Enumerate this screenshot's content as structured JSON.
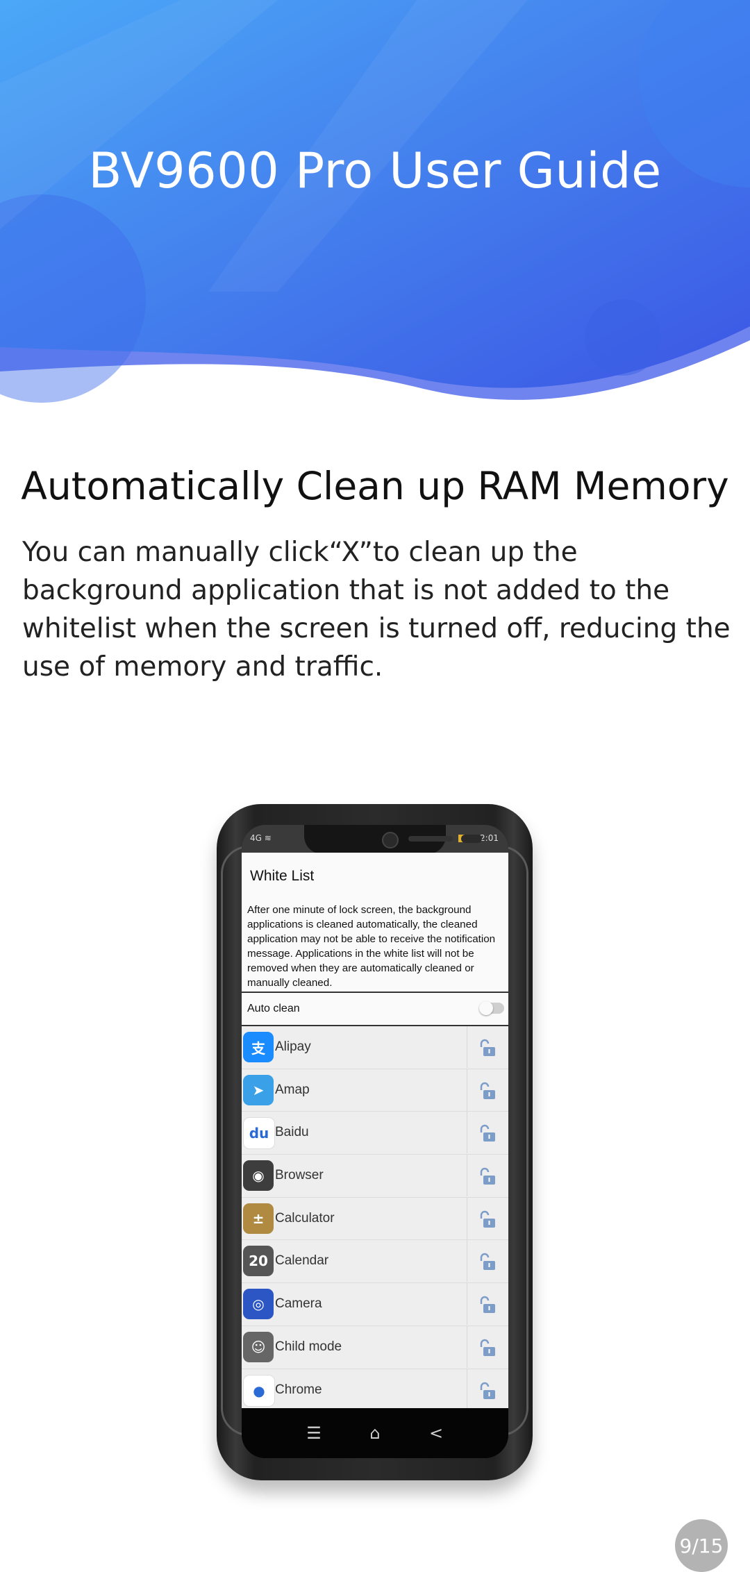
{
  "document": {
    "guide_title": "BV9600 Pro User Guide",
    "section_title": "Automatically Clean up RAM Memory",
    "section_body": "You can manually click“X”to clean up the background application that is not added to the whitelist when the screen is turned off, reducing the use of memory and traffic.",
    "page_indicator": "9/15"
  },
  "phone": {
    "status_bar": {
      "network": "4G",
      "time": "12:01"
    },
    "screen_title": "White List",
    "description": "After one minute of lock screen, the background applications is cleaned automatically, the cleaned application may not be able to receive the notification message. Applications in the white list will not be removed when they are automatically cleaned or manually cleaned.",
    "auto_clean": {
      "label": "Auto clean",
      "enabled": false
    },
    "apps": [
      {
        "name": "Alipay",
        "icon": "alipay-icon",
        "glyph": "支",
        "color": "#1a8cff",
        "locked": false
      },
      {
        "name": "Amap",
        "icon": "amap-icon",
        "glyph": "➤",
        "color": "#3aa0e8",
        "locked": false
      },
      {
        "name": "Baidu",
        "icon": "baidu-icon",
        "glyph": "du",
        "color": "#ffffff",
        "locked": false
      },
      {
        "name": "Browser",
        "icon": "browser-icon",
        "glyph": "◉",
        "color": "#3d3d3d",
        "locked": false
      },
      {
        "name": "Calculator",
        "icon": "calculator-icon",
        "glyph": "±",
        "color": "#b08a40",
        "locked": false
      },
      {
        "name": "Calendar",
        "icon": "calendar-icon",
        "glyph": "20",
        "color": "#555555",
        "locked": false
      },
      {
        "name": "Camera",
        "icon": "camera-icon",
        "glyph": "◎",
        "color": "#2b56c4",
        "locked": false
      },
      {
        "name": "Child mode",
        "icon": "child-mode-icon",
        "glyph": "☺",
        "color": "#666666",
        "locked": false
      },
      {
        "name": "Chrome",
        "icon": "chrome-icon",
        "glyph": "●",
        "color": "#ffffff",
        "locked": false
      }
    ],
    "nav": {
      "menu_icon": "menu-icon",
      "home_icon": "home-icon",
      "back_icon": "back-icon"
    }
  },
  "colors": {
    "header_blue_light": "#4aa6f5",
    "header_blue_dark": "#3f5be6",
    "page_badge": "#b3b3b3"
  }
}
